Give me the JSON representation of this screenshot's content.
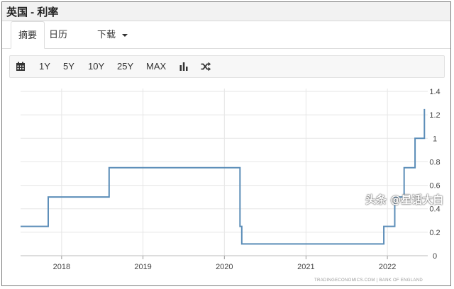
{
  "header": {
    "title": "英国 - 利率"
  },
  "tabs": [
    {
      "label": "摘要",
      "active": true
    },
    {
      "label": "日历",
      "active": false
    },
    {
      "label": "下载",
      "active": false,
      "dropdown": true
    }
  ],
  "toolbar": {
    "calendar_icon": "calendar-icon",
    "ranges": [
      "1Y",
      "5Y",
      "10Y",
      "25Y",
      "MAX"
    ],
    "bar_chart_icon": "bar-chart-icon",
    "shuffle_icon": "shuffle-icon"
  },
  "chart_data": {
    "type": "line",
    "title": "",
    "xlabel": "",
    "ylabel": "",
    "x_ticks": [
      "2018",
      "2019",
      "2020",
      "2021",
      "2022"
    ],
    "y_ticks": [
      "0",
      "0.2",
      "0.4",
      "0.6",
      "0.8",
      "1",
      "1.2",
      "1.4"
    ],
    "xlim": [
      "2017-07-01",
      "2022-07-01"
    ],
    "ylim": [
      0,
      1.4
    ],
    "grid": true,
    "line_color": "#5b8db8",
    "series": [
      {
        "points": [
          [
            "2017-07-01",
            0.25
          ],
          [
            "2017-11-02",
            0.25
          ],
          [
            "2017-11-02",
            0.5
          ],
          [
            "2018-08-02",
            0.5
          ],
          [
            "2018-08-02",
            0.75
          ],
          [
            "2020-03-11",
            0.75
          ],
          [
            "2020-03-11",
            0.25
          ],
          [
            "2020-03-19",
            0.25
          ],
          [
            "2020-03-19",
            0.1
          ],
          [
            "2021-12-16",
            0.1
          ],
          [
            "2021-12-16",
            0.25
          ],
          [
            "2022-02-03",
            0.25
          ],
          [
            "2022-02-03",
            0.5
          ],
          [
            "2022-03-17",
            0.5
          ],
          [
            "2022-03-17",
            0.75
          ],
          [
            "2022-05-05",
            0.75
          ],
          [
            "2022-05-05",
            1.0
          ],
          [
            "2022-06-16",
            1.0
          ],
          [
            "2022-06-16",
            1.25
          ]
        ]
      }
    ],
    "source_watermark": "TRADINGECONOMICS.COM | BANK OF ENGLAND"
  },
  "overlay": {
    "logo_text": "头条 @星话大白"
  }
}
